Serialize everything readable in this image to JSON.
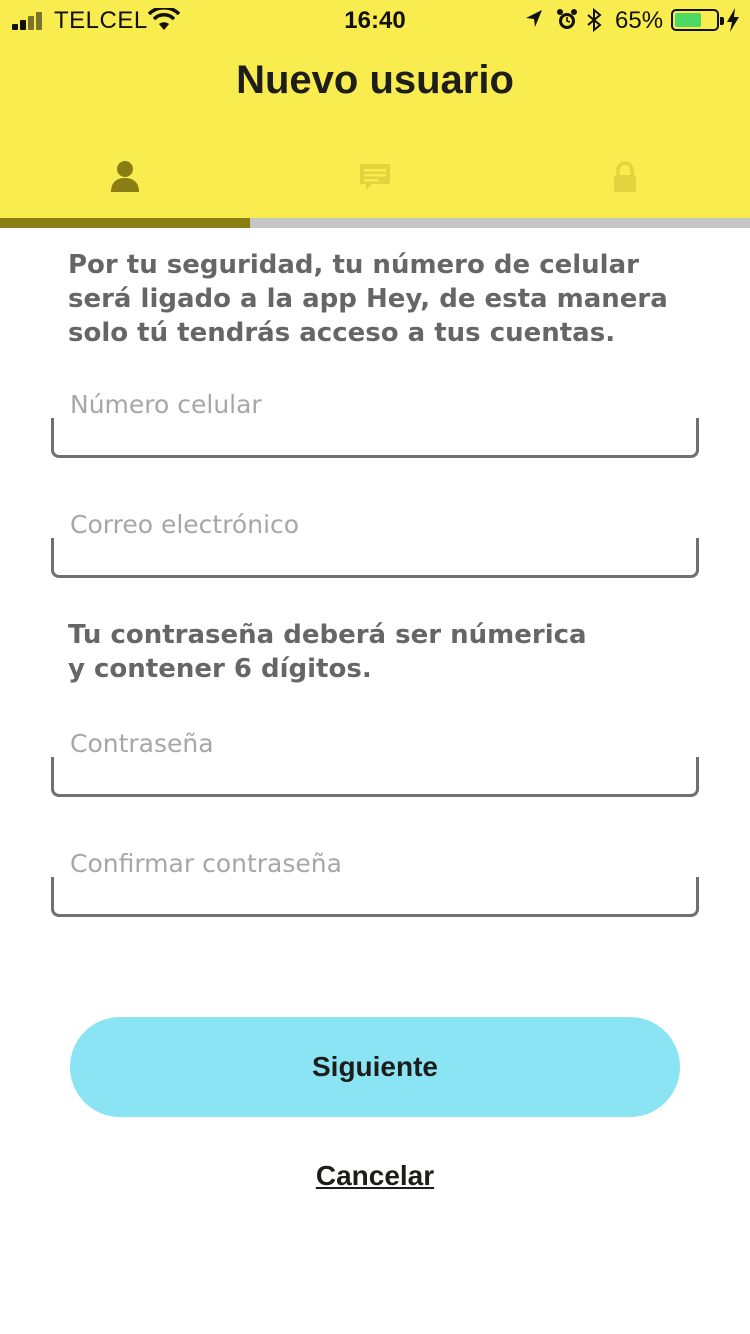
{
  "status_bar": {
    "carrier": "TELCEL",
    "time": "16:40",
    "battery_percent": "65%",
    "battery_level": 0.65,
    "icons": [
      "signal-icon",
      "wifi-icon",
      "location-icon",
      "alarm-icon",
      "bluetooth-icon",
      "battery-icon",
      "charging-icon"
    ]
  },
  "header": {
    "title": "Nuevo usuario",
    "background": "#f9ec4e"
  },
  "steps": {
    "items": [
      {
        "icon": "user-icon",
        "state": "active"
      },
      {
        "icon": "message-icon",
        "state": "inactive"
      },
      {
        "icon": "lock-icon",
        "state": "inactive"
      }
    ],
    "progress_fraction": 0.3333,
    "colors": {
      "active": "#8a7d14",
      "inactive": "#e3d43f",
      "track": "#c6c6c6"
    }
  },
  "form": {
    "intro": "Por tu seguridad, tu número de celular será ligado a la app Hey, de esta manera solo tú tendrás acceso a tus cuentas.",
    "phone": {
      "placeholder": "Número celular",
      "value": ""
    },
    "email": {
      "placeholder": "Correo electrónico",
      "value": ""
    },
    "password_note_line1": "Tu contraseña deberá ser númerica",
    "password_note_line2": "y contener 6 dígitos.",
    "password": {
      "placeholder": "Contraseña",
      "value": ""
    },
    "confirm_password": {
      "placeholder": "Confirmar contraseña",
      "value": ""
    }
  },
  "actions": {
    "next_label": "Siguiente",
    "next_color": "#8ae4f3",
    "cancel_label": "Cancelar"
  }
}
